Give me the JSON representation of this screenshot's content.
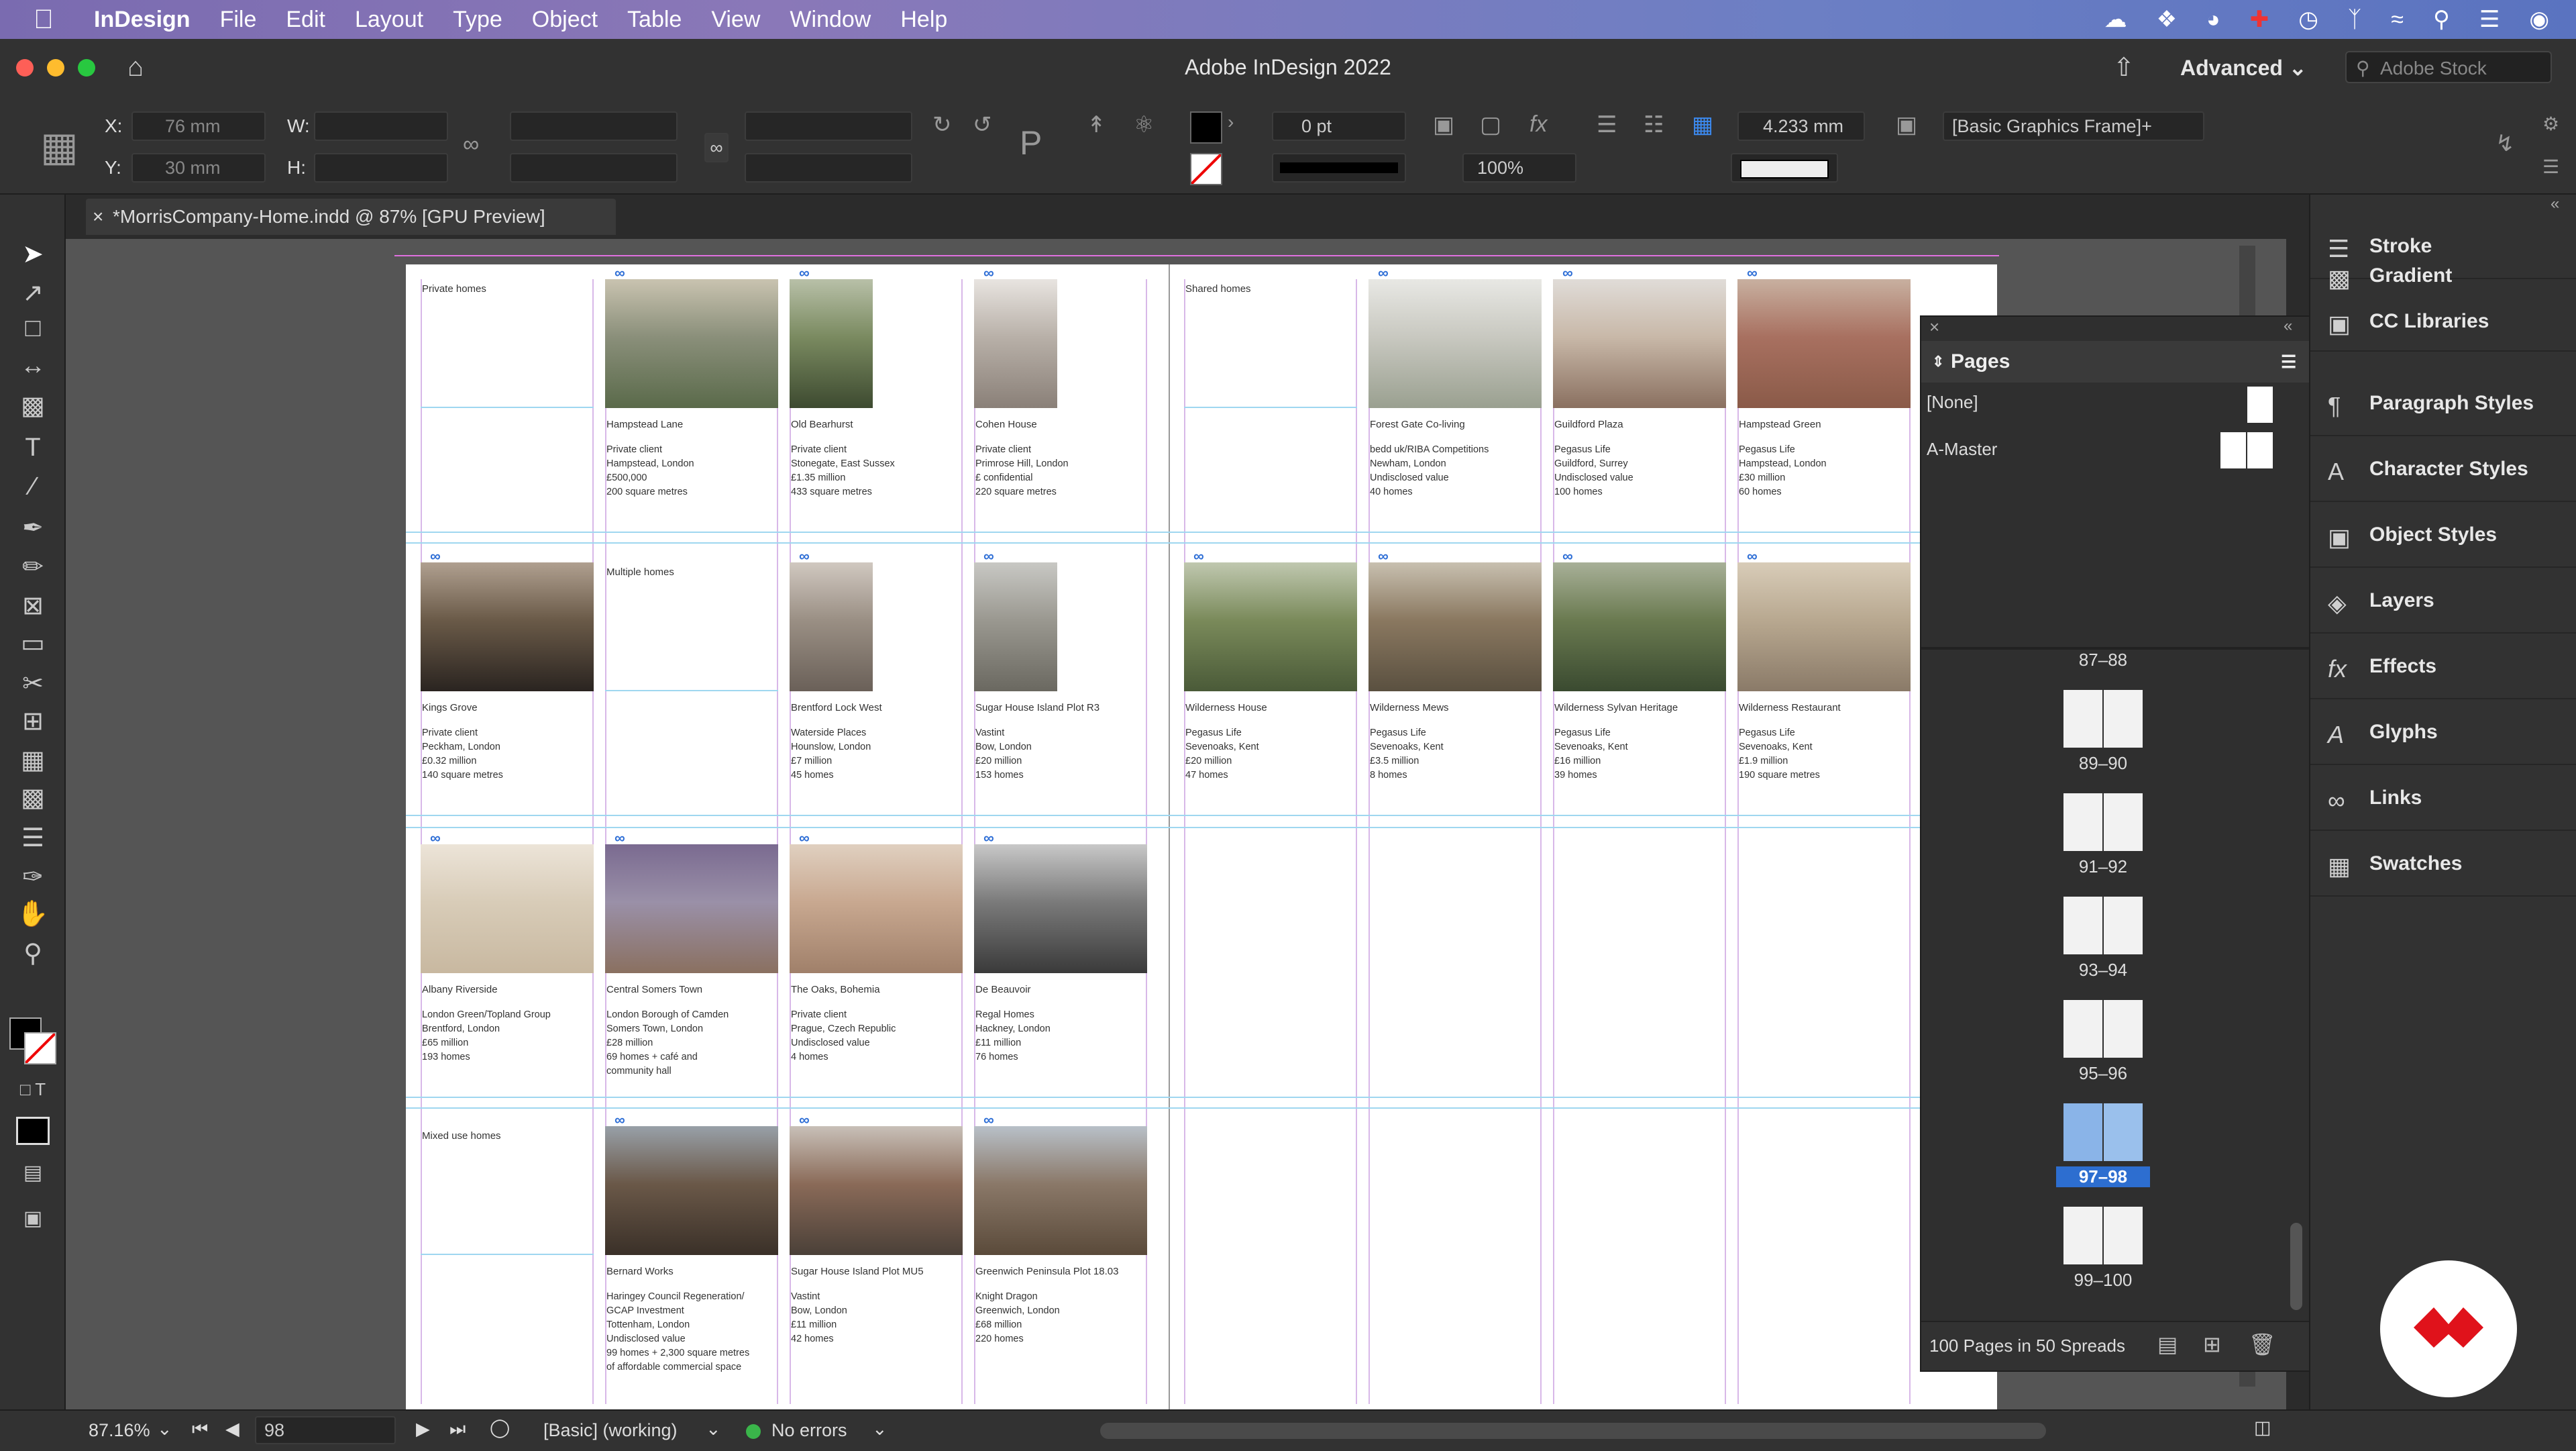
{
  "menubar": {
    "app_name": "InDesign",
    "items": [
      "File",
      "Edit",
      "Layout",
      "Type",
      "Object",
      "Table",
      "View",
      "Window",
      "Help"
    ]
  },
  "window": {
    "title": "Adobe InDesign 2022",
    "workspace": "Advanced",
    "stock_placeholder": "Adobe Stock"
  },
  "controls": {
    "x_label": "X:",
    "x_value": "76 mm",
    "y_label": "Y:",
    "y_value": "30 mm",
    "w_label": "W:",
    "h_label": "H:",
    "stroke_weight": "0 pt",
    "opacity": "100%",
    "dimension": "4.233 mm",
    "object_style": "[Basic Graphics Frame]+"
  },
  "document": {
    "tab_title": "*MorrisCompany-Home.indd @ 87% [GPU Preview]",
    "section_labels": {
      "private": "Private homes",
      "shared": "Shared homes",
      "multiple": "Multiple homes",
      "mixed": "Mixed use homes"
    },
    "projects": [
      {
        "title": "Hampstead Lane",
        "details": "Private client\nHampstead, London\n£500,000\n200 square metres"
      },
      {
        "title": "Old Bearhurst",
        "details": "Private client\nStonegate, East Sussex\n£1.35 million\n433 square metres"
      },
      {
        "title": "Cohen House",
        "details": "Private client\nPrimrose Hill, London\n£ confidential\n220 square metres"
      },
      {
        "title": "Forest Gate Co-living",
        "details": "bedd uk/RIBA Competitions\nNewham, London\nUndisclosed value\n40 homes"
      },
      {
        "title": "Guildford Plaza",
        "details": "Pegasus Life\nGuildford, Surrey\nUndisclosed value\n100 homes"
      },
      {
        "title": "Hampstead Green",
        "details": "Pegasus Life\nHampstead, London\n£30 million\n60 homes"
      },
      {
        "title": "Kings Grove",
        "details": "Private client\nPeckham, London\n£0.32 million\n140 square metres"
      },
      {
        "title": "Brentford Lock West",
        "details": "Waterside Places\nHounslow, London\n£7 million\n45 homes"
      },
      {
        "title": "Sugar House Island Plot R3",
        "details": "Vastint\nBow, London\n£20 million\n153 homes"
      },
      {
        "title": "Wilderness House",
        "details": "Pegasus Life\nSevenoaks, Kent\n£20 million\n47 homes"
      },
      {
        "title": "Wilderness Mews",
        "details": "Pegasus Life\nSevenoaks, Kent\n£3.5 million\n8 homes"
      },
      {
        "title": "Wilderness Sylvan Heritage",
        "details": "Pegasus Life\nSevenoaks, Kent\n£16 million\n39 homes"
      },
      {
        "title": "Wilderness Restaurant",
        "details": "Pegasus Life\nSevenoaks, Kent\n£1.9 million\n190 square metres"
      },
      {
        "title": "Albany Riverside",
        "details": "London Green/Topland Group\nBrentford, London\n£65 million\n193 homes"
      },
      {
        "title": "Central Somers Town",
        "details": "London Borough of Camden\nSomers Town, London\n£28 million\n69 homes + café and\ncommunity hall"
      },
      {
        "title": "The Oaks, Bohemia",
        "details": "Private client\nPrague, Czech Republic\nUndisclosed value\n4 homes"
      },
      {
        "title": "De Beauvoir",
        "details": "Regal Homes\nHackney, London\n£11 million\n76 homes"
      },
      {
        "title": "Bernard Works",
        "details": "Haringey Council Regeneration/\nGCAP Investment\nTottenham, London\nUndisclosed value\n99 homes + 2,300 square metres\nof affordable commercial space"
      },
      {
        "title": "Sugar House Island Plot MU5",
        "details": "Vastint\nBow, London\n£11 million\n42 homes"
      },
      {
        "title": "Greenwich Peninsula Plot 18.03",
        "details": "Knight Dragon\nGreenwich, London\n£68 million\n220 homes"
      }
    ]
  },
  "pages_panel": {
    "title": "Pages",
    "none_label": "[None]",
    "master_label": "A-Master",
    "spreads": [
      "87–88",
      "89–90",
      "91–92",
      "93–94",
      "95–96",
      "97–98",
      "99–100"
    ],
    "selected_spread": "97–98",
    "footer": "100 Pages in 50 Spreads"
  },
  "right_panels": [
    "Stroke",
    "Gradient",
    "CC Libraries",
    "Paragraph Styles",
    "Character Styles",
    "Object Styles",
    "Layers",
    "Effects",
    "Glyphs",
    "Links",
    "Swatches"
  ],
  "status": {
    "zoom": "87.16%",
    "page": "98",
    "preflight_profile": "[Basic] (working)",
    "errors": "No errors"
  }
}
